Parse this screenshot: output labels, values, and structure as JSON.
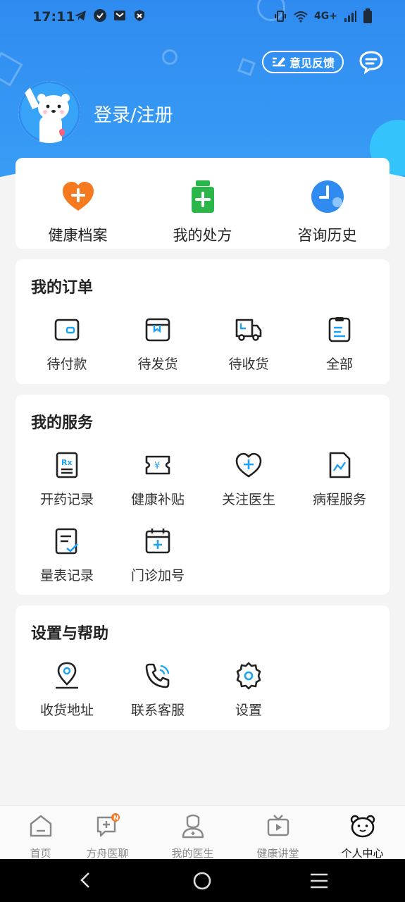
{
  "status_bar": {
    "time": "17:11",
    "network": "4G+"
  },
  "header": {
    "feedback_label": "意见反馈",
    "login_label": "登录/注册"
  },
  "quick_actions": [
    {
      "label": "健康档案",
      "icon": "heart-plus-icon",
      "color": "#f57a1f"
    },
    {
      "label": "我的处方",
      "icon": "medicine-bottle-icon",
      "color": "#2bb64a"
    },
    {
      "label": "咨询历史",
      "icon": "clock-icon",
      "color": "#2f8bf0"
    }
  ],
  "orders": {
    "title": "我的订单",
    "items": [
      {
        "label": "待付款",
        "icon": "wallet-icon"
      },
      {
        "label": "待发货",
        "icon": "package-icon"
      },
      {
        "label": "待收货",
        "icon": "truck-icon"
      },
      {
        "label": "全部",
        "icon": "clipboard-icon"
      }
    ]
  },
  "services": {
    "title": "我的服务",
    "items": [
      {
        "label": "开药记录",
        "icon": "prescription-icon"
      },
      {
        "label": "健康补贴",
        "icon": "coupon-icon"
      },
      {
        "label": "关注医生",
        "icon": "heart-plus-outline-icon"
      },
      {
        "label": "病程服务",
        "icon": "chart-document-icon"
      },
      {
        "label": "量表记录",
        "icon": "checklist-icon"
      },
      {
        "label": "门诊加号",
        "icon": "calendar-plus-icon"
      }
    ]
  },
  "settings": {
    "title": "设置与帮助",
    "items": [
      {
        "label": "收货地址",
        "icon": "location-pin-icon"
      },
      {
        "label": "联系客服",
        "icon": "phone-icon"
      },
      {
        "label": "设置",
        "icon": "gear-icon"
      }
    ]
  },
  "tabbar": [
    {
      "label": "首页",
      "icon": "home-icon"
    },
    {
      "label": "方舟医聊",
      "icon": "chat-plus-icon",
      "badge": "N"
    },
    {
      "label": "我的医生",
      "icon": "doctor-icon"
    },
    {
      "label": "健康讲堂",
      "icon": "tv-icon"
    },
    {
      "label": "个人中心",
      "icon": "bear-face-icon",
      "active": true
    }
  ],
  "colors": {
    "primary": "#2f8bf0",
    "accent": "#1da1f2",
    "badge": "#f57a1f"
  }
}
